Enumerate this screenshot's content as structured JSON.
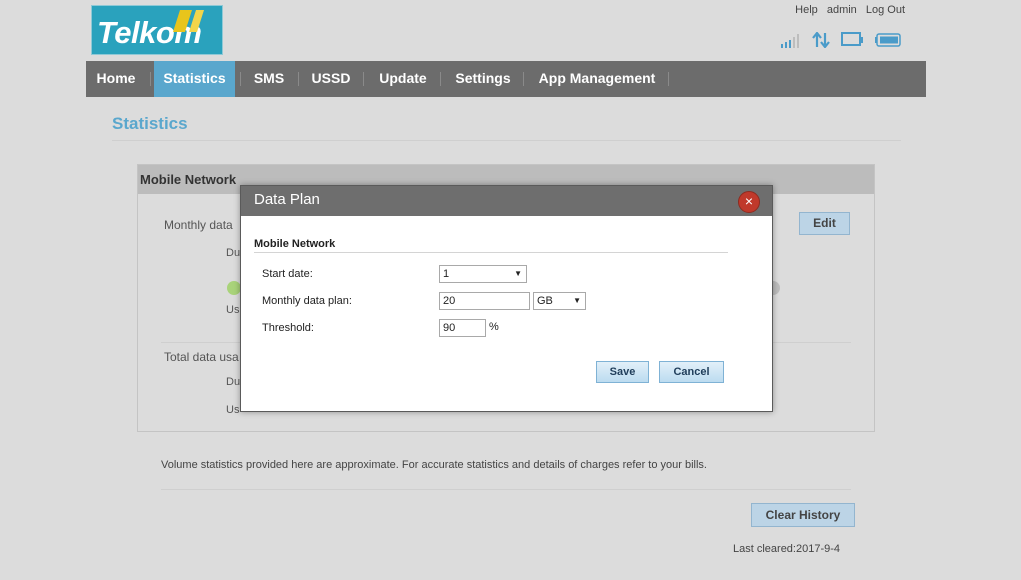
{
  "brand": {
    "logo_text": "Telkom",
    "color": "#2aa2bd"
  },
  "top_links": {
    "help": "Help",
    "admin": "admin",
    "logout": "Log Out"
  },
  "status_icons": [
    "signal-icon",
    "data-transfer-icon",
    "monitor-icon",
    "battery-icon"
  ],
  "nav": {
    "items": [
      {
        "label": "Home"
      },
      {
        "label": "Statistics",
        "active": true
      },
      {
        "label": "SMS"
      },
      {
        "label": "USSD"
      },
      {
        "label": "Update"
      },
      {
        "label": "Settings"
      },
      {
        "label": "App Management"
      }
    ],
    "active_color": "#5aa7cd"
  },
  "page": {
    "title": "Statistics",
    "panel_title": "Mobile Network",
    "monthly_label": "Monthly data",
    "du1": "Du",
    "us1": "Us",
    "total_label": "Total data usa",
    "du2": "Du",
    "us2": "Us",
    "edit_label": "Edit",
    "footnote": "Volume statistics provided here are approximate. For accurate statistics and details of charges refer to your bills.",
    "clear_history_label": "Clear History",
    "last_cleared": "Last cleared:2017-9-4"
  },
  "dialog": {
    "title": "Data Plan",
    "section": "Mobile Network",
    "start_date_label": "Start date:",
    "start_date_value": "1",
    "monthly_plan_label": "Monthly data plan:",
    "monthly_plan_value": "20",
    "monthly_plan_unit": "GB",
    "threshold_label": "Threshold:",
    "threshold_value": "90",
    "threshold_unit": "%",
    "save_label": "Save",
    "cancel_label": "Cancel"
  }
}
